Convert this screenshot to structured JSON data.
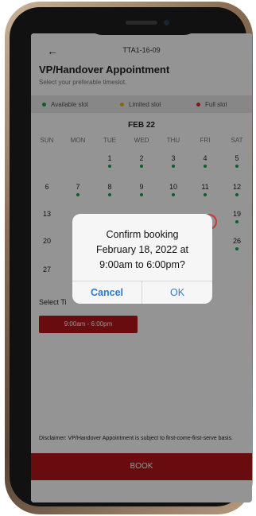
{
  "header": {
    "back_icon": "back-arrow-icon",
    "unit_code": "TTA1-16-09"
  },
  "page": {
    "title": "VP/Handover Appointment",
    "subtitle": "Select your preferable timeslot."
  },
  "legend": {
    "available": {
      "label": "Available slot",
      "color": "#16a34a"
    },
    "limited": {
      "label": "Limited slot",
      "color": "#e5b50a"
    },
    "full": {
      "label": "Full slot",
      "color": "#dc2626"
    }
  },
  "calendar": {
    "month": "FEB 22",
    "weekdays": [
      "SUN",
      "MON",
      "TUE",
      "WED",
      "THU",
      "FRI",
      "SAT"
    ],
    "days": [
      {
        "n": "1",
        "col": 2,
        "row": 0,
        "dot": true
      },
      {
        "n": "2",
        "col": 3,
        "row": 0,
        "dot": true
      },
      {
        "n": "3",
        "col": 4,
        "row": 0,
        "dot": true
      },
      {
        "n": "4",
        "col": 5,
        "row": 0,
        "dot": true
      },
      {
        "n": "5",
        "col": 6,
        "row": 0,
        "dot": true
      },
      {
        "n": "6",
        "col": 0,
        "row": 1,
        "dot": false
      },
      {
        "n": "7",
        "col": 1,
        "row": 1,
        "dot": true
      },
      {
        "n": "8",
        "col": 2,
        "row": 1,
        "dot": true
      },
      {
        "n": "9",
        "col": 3,
        "row": 1,
        "dot": true
      },
      {
        "n": "10",
        "col": 4,
        "row": 1,
        "dot": true
      },
      {
        "n": "11",
        "col": 5,
        "row": 1,
        "dot": true
      },
      {
        "n": "12",
        "col": 6,
        "row": 1,
        "dot": true
      },
      {
        "n": "13",
        "col": 0,
        "row": 2,
        "dot": false
      },
      {
        "n": "19",
        "col": 6,
        "row": 2,
        "dot": true
      },
      {
        "n": "20",
        "col": 0,
        "row": 3,
        "dot": false
      },
      {
        "n": "26",
        "col": 6,
        "row": 3,
        "dot": true
      },
      {
        "n": "27",
        "col": 0,
        "row": 4,
        "dot": false
      }
    ]
  },
  "time": {
    "label": "Select Ti",
    "slot": "9:00am - 6:00pm"
  },
  "disclaimer": "Disclaimer: VP/Handover Appointment is subject to first-come-first-serve basis.",
  "book_label": "BOOK",
  "dialog": {
    "line1": "Confirm booking",
    "line2": "February 18, 2022 at",
    "line3": "9:00am to 6:00pm?",
    "cancel": "Cancel",
    "ok": "OK"
  }
}
